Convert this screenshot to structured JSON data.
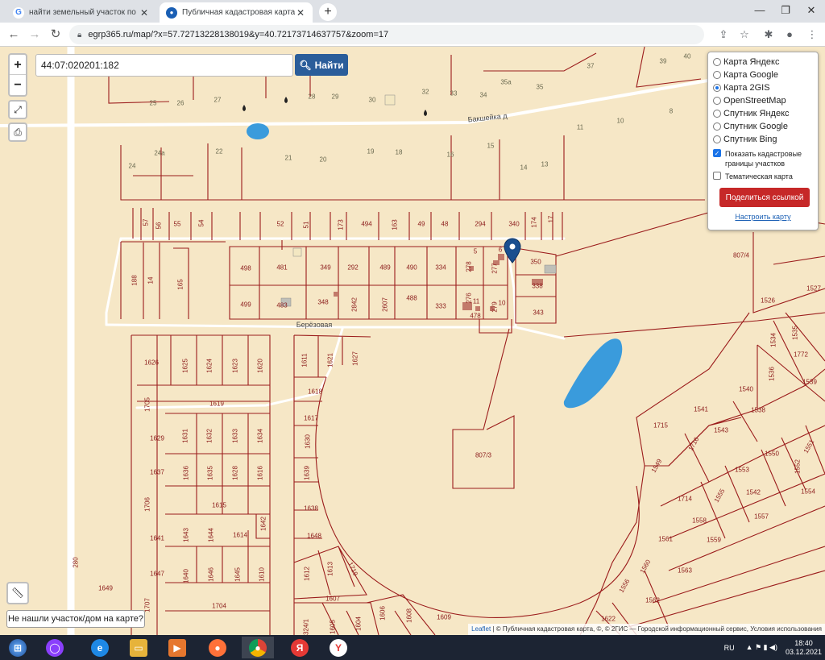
{
  "browser": {
    "tabs": [
      {
        "title": "найти земельный участок по ка",
        "favicon": "G"
      },
      {
        "title": "Публичная кадастровая карта К",
        "favicon": "pin"
      }
    ],
    "url": "egrp365.ru/map/?x=57.72713228138019&y=40.72173714637757&zoom=17"
  },
  "search": {
    "value": "44:07:020201:182",
    "button": "Найти"
  },
  "layers": {
    "options": [
      "Карта Яндекс",
      "Карта Google",
      "Карта 2GIS",
      "OpenStreetMap",
      "Спутник Яндекс",
      "Спутник Google",
      "Спутник Bing"
    ],
    "selected": "Карта 2GIS",
    "checks": [
      {
        "label": "Показать кадастровые границы участков",
        "checked": true
      },
      {
        "label": "Тематическая карта",
        "checked": false
      }
    ],
    "share": "Поделиться ссылкой",
    "configure": "Настроить карту"
  },
  "map": {
    "streets": [
      "Бакшейка д",
      "Берёзовая"
    ],
    "house_numbers": [
      "25",
      "26",
      "27",
      "28",
      "29",
      "30",
      "32",
      "33",
      "34",
      "35а",
      "35",
      "37",
      "39",
      "40",
      "24а",
      "22",
      "21",
      "20",
      "19",
      "18",
      "16",
      "15",
      "14",
      "13",
      "11",
      "10",
      "8",
      "24"
    ],
    "parcels": [
      "57",
      "56",
      "55",
      "54",
      "52",
      "51",
      "173",
      "494",
      "163",
      "49",
      "48",
      "294",
      "340",
      "174",
      "17",
      "498",
      "481",
      "349",
      "292",
      "489",
      "490",
      "334",
      "278",
      "277",
      "350",
      "5",
      "6",
      "499",
      "483",
      "348",
      "2842",
      "2607",
      "488",
      "333",
      "276",
      "279",
      "478",
      "11",
      "10",
      "338",
      "343",
      "188",
      "14",
      "165",
      "807/4",
      "1527",
      "1526",
      "1534",
      "1535",
      "1772",
      "1536",
      "1539",
      "1540",
      "1538",
      "1541",
      "1543",
      "1715",
      "1716",
      "1551",
      "1550",
      "1552",
      "1554",
      "1553",
      "1542",
      "1549",
      "1714",
      "1555",
      "1557",
      "1558",
      "1559",
      "1561",
      "1560",
      "1563",
      "1556",
      "1562",
      "1622",
      "1626",
      "1625",
      "1624",
      "1623",
      "1620",
      "1611",
      "1621",
      "1627",
      "1705",
      "1619",
      "1618",
      "1617",
      "1630",
      "1629",
      "1631",
      "1632",
      "1633",
      "1634",
      "1637",
      "1636",
      "1635",
      "1628",
      "1616",
      "1639",
      "1706",
      "1615",
      "1638",
      "1642",
      "1641",
      "1643",
      "1644",
      "1614",
      "1648",
      "1647",
      "1640",
      "1646",
      "1645",
      "1610",
      "1612",
      "1613",
      "1719",
      "1649",
      "1707",
      "1704",
      "1607",
      "1606",
      "1608",
      "1605",
      "1604",
      "1609",
      "324/1",
      "280",
      "807/3"
    ]
  },
  "controls": {
    "zoom_in": "+",
    "zoom_out": "−",
    "not_found": "Не нашли участок/дом на карте?"
  },
  "attribution": {
    "leaflet": "Leaflet",
    "text": " | © Публичная кадастровая карта, ©, © 2ГИС — Городской информационный сервис, Условия использования"
  },
  "taskbar": {
    "lang": "RU",
    "time": "18:40",
    "date": "03.12.2021"
  },
  "colors": {
    "parcel": "#9b1c1c",
    "water": "#3a9bdc",
    "map_bg": "#f6e7c6",
    "share": "#c62828"
  }
}
